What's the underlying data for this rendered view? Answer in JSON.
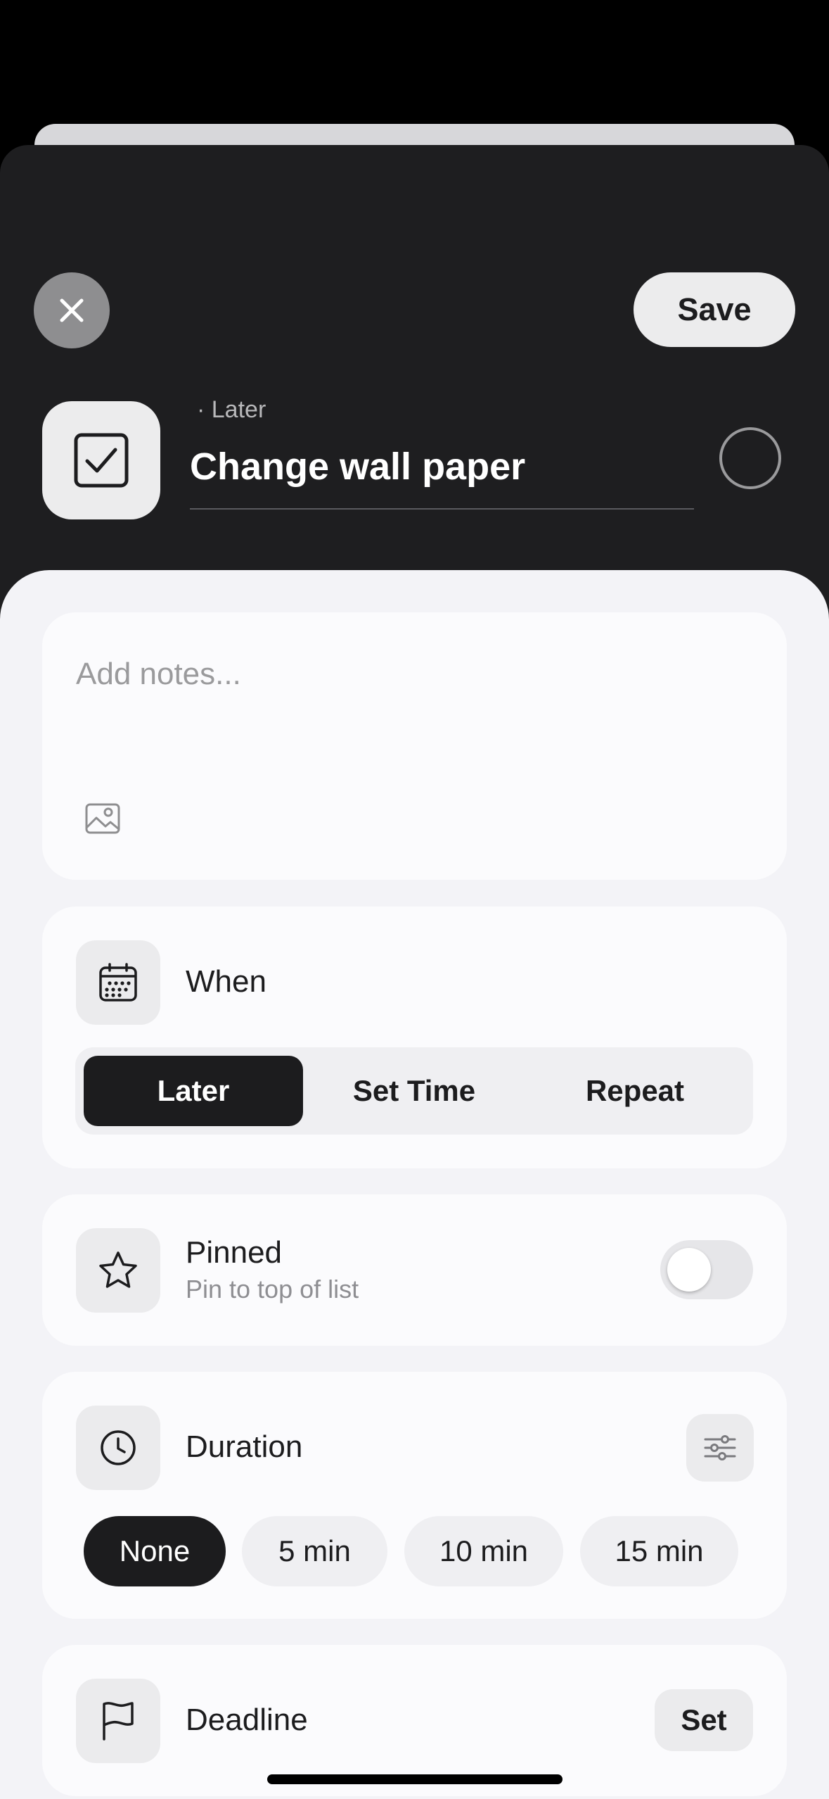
{
  "header": {
    "save_label": "Save",
    "task_subtitle": "· Later",
    "task_title": "Change wall paper"
  },
  "notes": {
    "placeholder": "Add notes..."
  },
  "when": {
    "label": "When",
    "options": [
      "Later",
      "Set Time",
      "Repeat"
    ],
    "selected": "Later"
  },
  "pinned": {
    "label": "Pinned",
    "description": "Pin to top of list",
    "enabled": false
  },
  "duration": {
    "label": "Duration",
    "options": [
      "None",
      "5 min",
      "10 min",
      "15 min"
    ],
    "selected": "None"
  },
  "deadline": {
    "label": "Deadline",
    "action_label": "Set"
  },
  "colors": {
    "dark_sheet": "#1e1e20",
    "light_background": "#f3f3f7",
    "card": "#fbfbfd",
    "active": "#1c1c1e"
  }
}
